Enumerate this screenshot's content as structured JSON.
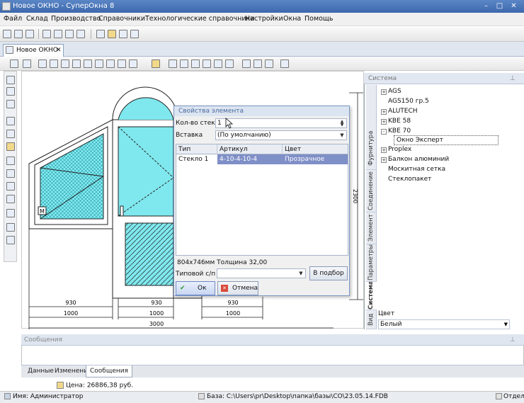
{
  "window": {
    "title": "Новое ОКНО - СуперОкна 8",
    "min": "–",
    "max": "□",
    "close": "✕"
  },
  "menu": [
    "Файл",
    "Склад",
    "Производство",
    "Справочники",
    "Технологические справочники",
    "Настройки",
    "Окна",
    "Помощь"
  ],
  "doc_tab": {
    "label": "Новое ОКНО",
    "close": "✕"
  },
  "drawing": {
    "dims_bottom_row1": [
      "930",
      "930",
      "930"
    ],
    "dims_bottom_row2": [
      "1000",
      "1000",
      "1000"
    ],
    "dims_bottom_total": "3000",
    "dim_right": "2300",
    "handle_mark": "M"
  },
  "right_panel": {
    "header": "Система",
    "pin": "⊥",
    "vtabs": [
      "Вид",
      "Система",
      "Параметры",
      "Элемент",
      "Соединение",
      "Фурнитура"
    ],
    "tree": [
      {
        "label": "AGS",
        "expand": "+"
      },
      {
        "label": "AGS150 гр.5",
        "expand": ""
      },
      {
        "label": "ALUTECH",
        "expand": "+"
      },
      {
        "label": "KBE 58",
        "expand": "+"
      },
      {
        "label": "KBE 70",
        "expand": "-"
      },
      {
        "label": "Окно Эксперт",
        "expand": ""
      },
      {
        "label": "Proplex",
        "expand": "+"
      },
      {
        "label": "Балкон алюминий",
        "expand": "+"
      },
      {
        "label": "Москитная сетка",
        "expand": ""
      },
      {
        "label": "Стеклопакет",
        "expand": ""
      }
    ],
    "color_label": "Цвет",
    "color_value": "Белый"
  },
  "dialog": {
    "title": "Свойства элемента",
    "count_label": "Кол-во стекол",
    "count_value": "1",
    "insert_label": "Вставка",
    "insert_value": "(По умолчанию)",
    "columns": [
      "Тип",
      "Артикул",
      "Цвет"
    ],
    "row": {
      "type": "Стекло 1",
      "article": "4-10-4-10-4",
      "color": "Прозрачное"
    },
    "info": "804x746мм  Толщина 32,00",
    "typical_label": "Типовой с/п",
    "select_button": "В подбор",
    "ok": "Ок",
    "cancel": "Отмена"
  },
  "messages": {
    "header": "Сообщения",
    "tabs": [
      "Данные",
      "Изменения",
      "Сообщения"
    ]
  },
  "status": {
    "user": "Имя: Администратор",
    "price": "Цена: 26886,38 руб.",
    "base": "База: C:\\Users\\pr\\Desktop\\папка\\базы\\СО\\23.05.14.FDB",
    "dept": "Отдел:"
  }
}
